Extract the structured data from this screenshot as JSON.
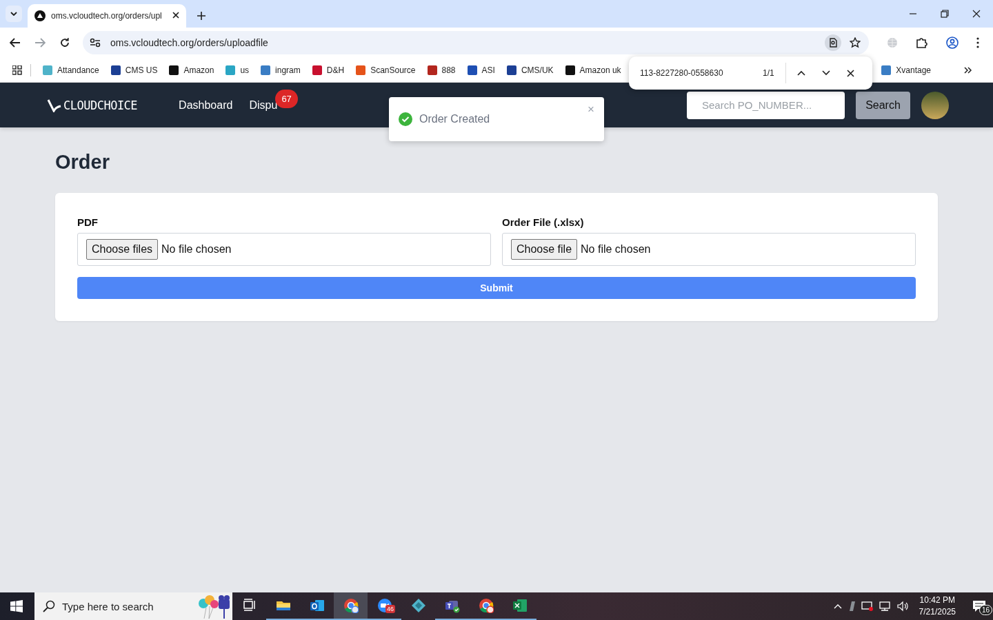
{
  "browser": {
    "tabs": [
      {
        "title": "oms.vcloudtech.org/orders/upl",
        "selected": true
      }
    ],
    "address": "oms.vcloudtech.org/orders/uploadfile",
    "bookmarks": [
      {
        "label": "Attandance",
        "color": "#4fb3c9"
      },
      {
        "label": "CMS US",
        "color": "#1c3f94"
      },
      {
        "label": "Amazon",
        "color": "#111111"
      },
      {
        "label": "us",
        "color": "#2aa6c4"
      },
      {
        "label": "ingram",
        "color": "#3a7dc4"
      },
      {
        "label": "D&H",
        "color": "#c8102e"
      },
      {
        "label": "ScanSource",
        "color": "#e5531a"
      },
      {
        "label": "888",
        "color": "#b3261e"
      },
      {
        "label": "ASI",
        "color": "#1e4fb3"
      },
      {
        "label": "CMS/UK",
        "color": "#1c3f94"
      },
      {
        "label": "Amazon uk",
        "color": "#111111"
      }
    ],
    "bookmarks_right": [
      {
        "label": "Xvantage",
        "color": "#3a7dc4"
      }
    ],
    "find_bar": {
      "query": "113-8227280-0558630",
      "count": "1/1"
    }
  },
  "app": {
    "logo": "CLOUDCHOICE",
    "nav": [
      {
        "label": "Dashboard"
      },
      {
        "label": "Dispu",
        "badge": "67"
      }
    ],
    "search": {
      "placeholder": "Search PO_NUMBER..."
    },
    "search_button": "Search"
  },
  "toast": {
    "message": "Order Created",
    "close": "×"
  },
  "page": {
    "title": "Order",
    "fields": [
      {
        "label": "PDF",
        "button": "Choose files",
        "status": "No file chosen"
      },
      {
        "label": "Order File (.xlsx)",
        "button": "Choose file",
        "status": "No file chosen"
      }
    ],
    "submit": "Submit"
  },
  "taskbar": {
    "search_placeholder": "Type here to search",
    "apps": [
      {
        "kind": "taskview",
        "selected": false,
        "running": false
      },
      {
        "kind": "explorer",
        "selected": false,
        "running": true
      },
      {
        "kind": "outlook",
        "selected": false,
        "running": true
      },
      {
        "kind": "chrome",
        "selected": true,
        "running": true
      },
      {
        "kind": "zoom",
        "selected": false,
        "running": true,
        "badge": "46"
      },
      {
        "kind": "diamond",
        "selected": false,
        "running": false
      },
      {
        "kind": "teams",
        "selected": false,
        "running": true
      },
      {
        "kind": "chrome2",
        "selected": false,
        "running": true
      },
      {
        "kind": "excel",
        "selected": false,
        "running": true
      }
    ],
    "time": "10:42 PM",
    "date": "7/21/2025",
    "notifications": "16"
  }
}
